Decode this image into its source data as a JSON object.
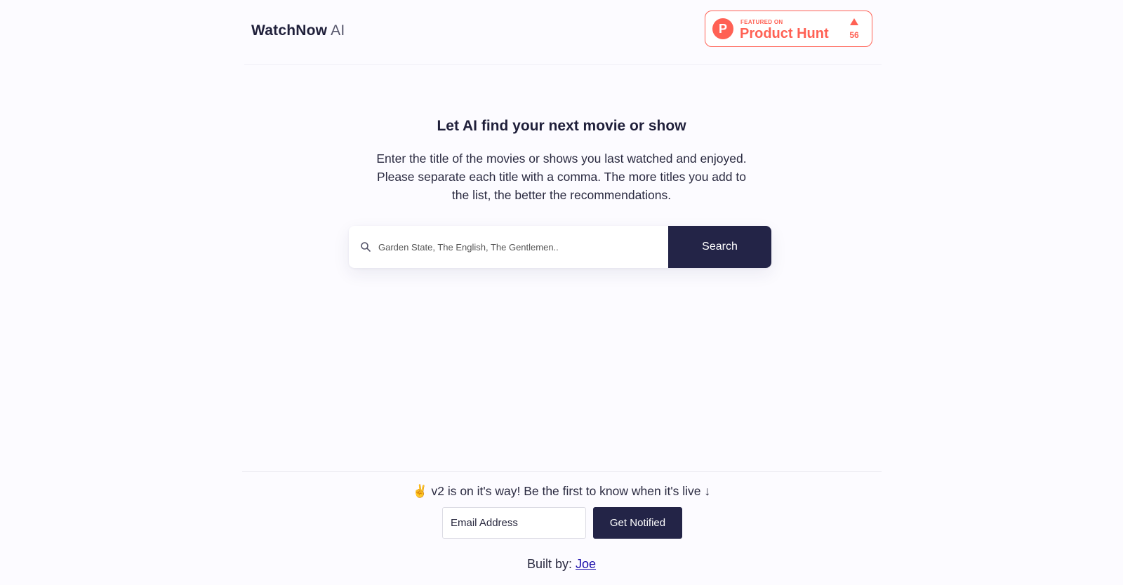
{
  "header": {
    "logo_bold": "WatchNow",
    "logo_light": "AI",
    "product_hunt": {
      "small_label": "FEATURED ON",
      "name": "Product Hunt",
      "logo_letter": "P",
      "upvotes": "56",
      "color": "#ff6154"
    }
  },
  "hero": {
    "title": "Let AI find your next movie or show",
    "description": "Enter the title of the movies or shows you last watched and enjoyed. Please separate each title with a comma. The more titles you add to the list, the better the recommendations."
  },
  "search": {
    "icon": "search-icon",
    "placeholder": "Garden State, The English, The Gentlemen..",
    "value": "",
    "button_label": "Search"
  },
  "footer": {
    "announcement": "✌️ v2 is on it's way! Be the first to know when it's live ↓",
    "email_placeholder": "Email Address",
    "notify_label": "Get Notified",
    "built_by_label": "Built by:",
    "author": "Joe"
  },
  "colors": {
    "primary_dark": "#232447",
    "background": "#fcfbff",
    "link": "#1a0dab"
  }
}
